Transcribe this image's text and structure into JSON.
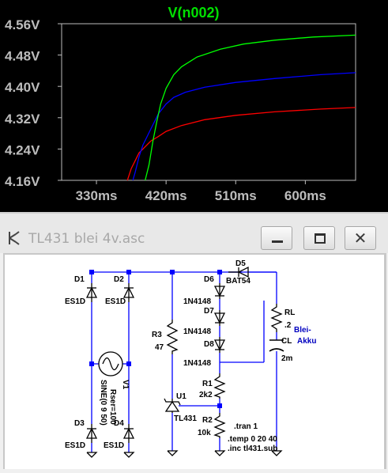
{
  "waveform": {
    "trace_title": "V(n002)",
    "title_color": "#00e000",
    "background": "#000000",
    "axis_color": "#bdbdbd"
  },
  "chart_data": {
    "type": "line",
    "title": "V(n002)",
    "xlabel": "",
    "ylabel": "",
    "xlim": [
      285,
      665
    ],
    "ylim": [
      4.16,
      4.56
    ],
    "x_ticks": [
      "330ms",
      "420ms",
      "510ms",
      "600ms"
    ],
    "y_ticks": [
      "4.56V",
      "4.48V",
      "4.40V",
      "4.32V",
      "4.24V",
      "4.16V"
    ],
    "grid": false,
    "series": [
      {
        "color": "#ff0000",
        "x": [
          370,
          375,
          380,
          385,
          390,
          400,
          410,
          420,
          440,
          470,
          510,
          560,
          620,
          665
        ],
        "y": [
          4.16,
          4.19,
          4.21,
          4.23,
          4.24,
          4.26,
          4.272,
          4.285,
          4.3,
          4.315,
          4.326,
          4.335,
          4.342,
          4.346
        ]
      },
      {
        "color": "#0000ff",
        "x": [
          377,
          380,
          385,
          390,
          400,
          410,
          420,
          430,
          445,
          470,
          510,
          560,
          620,
          665
        ],
        "y": [
          4.16,
          4.18,
          4.22,
          4.25,
          4.29,
          4.33,
          4.355,
          4.372,
          4.385,
          4.398,
          4.41,
          4.42,
          4.43,
          4.435
        ]
      },
      {
        "color": "#00ff00",
        "x": [
          393,
          398,
          403,
          408,
          413,
          420,
          430,
          440,
          460,
          490,
          520,
          560,
          610,
          665
        ],
        "y": [
          4.16,
          4.2,
          4.26,
          4.31,
          4.355,
          4.395,
          4.43,
          4.45,
          4.475,
          4.495,
          4.508,
          4.518,
          4.526,
          4.531
        ]
      }
    ]
  },
  "window": {
    "title": "TL431 blei 4v.asc",
    "minimize_label": "minimize",
    "maximize_label": "maximize",
    "close_glyph": "✕"
  },
  "schematic": {
    "labels": {
      "d1": "D1",
      "d1_model": "ES1D",
      "d2": "D2",
      "d2_model": "ES1D",
      "d3": "D3",
      "d3_model": "ES1D",
      "d4": "D4",
      "d4_model": "ES1D",
      "v1": "V1",
      "v1_value": "SINE(0 9 50)",
      "v1_rser": "Rser=100",
      "r3": "R3",
      "r3_value": "47",
      "d6": "D6",
      "d6_model": "1N4148",
      "d7": "D7",
      "d7_model": "1N4148",
      "d8": "D8",
      "d8_model": "1N4148",
      "d5": "D5",
      "d5_model": "BAT54",
      "r1": "R1",
      "r1_value": "2k2",
      "r2": "R2",
      "r2_value": "10k",
      "u1": "U1",
      "u1_model": "TL431",
      "rl": "RL",
      "rl_value": ".2",
      "cl": "CL",
      "cl_value": "2m",
      "note_line1": "Blei-",
      "note_line2": "Akku",
      "directive_tran": ".tran 1",
      "directive_temp": ".temp 0 20 40",
      "directive_inc": ".inc tl431.sub"
    },
    "colors": {
      "wire": "#0000ff",
      "component": "#000000",
      "text": "#000000",
      "note": "#0000c0",
      "junction": "#0000ff"
    }
  }
}
